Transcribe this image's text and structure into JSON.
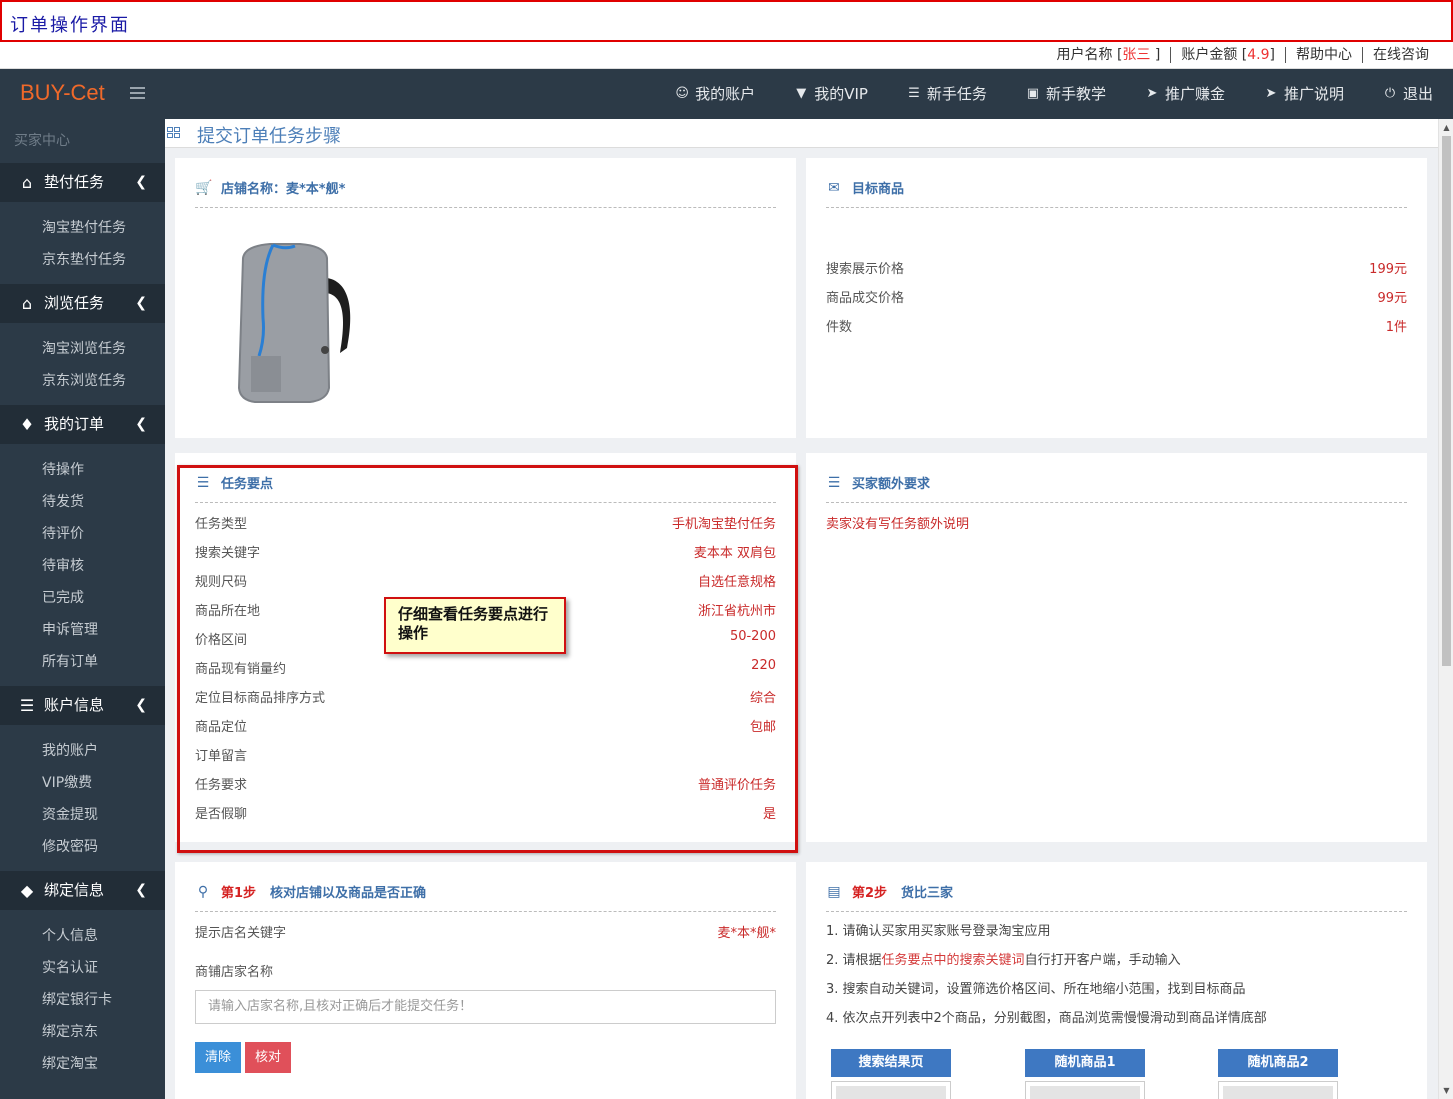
{
  "window_title": "订单操作界面",
  "topinfo": {
    "username_label": "用户名称 [",
    "username": "张三",
    "username_end": "]",
    "balance_label": "账户金额 [",
    "balance": "4.9",
    "balance_end": "]",
    "help": "帮助中心",
    "consult": "在线咨询"
  },
  "navbar": {
    "logo": "BUY-Cet",
    "links": [
      {
        "label": "我的账户",
        "icon": "user-icon"
      },
      {
        "label": "我的VIP",
        "icon": "vip-icon"
      },
      {
        "label": "新手任务",
        "icon": "task-icon"
      },
      {
        "label": "新手教学",
        "icon": "film-icon"
      },
      {
        "label": "推广赚金",
        "icon": "send-icon"
      },
      {
        "label": "推广说明",
        "icon": "send-icon"
      },
      {
        "label": "退出",
        "icon": "power-icon"
      }
    ]
  },
  "sidebar": {
    "header": "买家中心",
    "groups": [
      {
        "label": "垫付任务",
        "icon": "home-icon",
        "items": [
          "淘宝垫付任务",
          "京东垫付任务"
        ]
      },
      {
        "label": "浏览任务",
        "icon": "home-icon",
        "items": [
          "淘宝浏览任务",
          "京东浏览任务"
        ]
      },
      {
        "label": "我的订单",
        "icon": "tag-icon",
        "items": [
          "待操作",
          "待发货",
          "待评价",
          "待审核",
          "已完成",
          "申诉管理",
          "所有订单"
        ]
      },
      {
        "label": "账户信息",
        "icon": "layers-icon",
        "items": [
          "我的账户",
          "VIP缴费",
          "资金提现",
          "修改密码"
        ]
      },
      {
        "label": "绑定信息",
        "icon": "diamond-icon",
        "items": [
          "个人信息",
          "实名认证",
          "绑定银行卡",
          "绑定京东",
          "绑定淘宝"
        ]
      }
    ]
  },
  "page": {
    "title": "提交订单任务步骤"
  },
  "shop_card": {
    "title": "店铺名称：麦*本*舰*"
  },
  "target_card": {
    "title": "目标商品",
    "rows": [
      {
        "k": "搜索展示价格",
        "v": "199元"
      },
      {
        "k": "商品成交价格",
        "v": "99元"
      },
      {
        "k": "件数",
        "v": "1件"
      }
    ]
  },
  "task_card": {
    "title": "任务要点",
    "rows": [
      {
        "k": "任务类型",
        "v": "手机淘宝垫付任务"
      },
      {
        "k": "搜索关键字",
        "v": "麦本本 双肩包"
      },
      {
        "k": "规则尺码",
        "v": "自选任意规格"
      },
      {
        "k": "商品所在地",
        "v": "浙江省杭州市"
      },
      {
        "k": "价格区间",
        "v": "50-200"
      },
      {
        "k": "商品现有销量约",
        "v": "220"
      },
      {
        "k": "定位目标商品排序方式",
        "v": "综合"
      },
      {
        "k": "商品定位",
        "v": "包邮"
      },
      {
        "k": "订单留言",
        "v": ""
      },
      {
        "k": "任务要求",
        "v": "普通评价任务"
      },
      {
        "k": "是否假聊",
        "v": "是"
      }
    ]
  },
  "extra_card": {
    "title": "买家额外要求",
    "text": "卖家没有写任务额外说明"
  },
  "callout": {
    "text": "仔细查看任务要点进行操作"
  },
  "step1_card": {
    "step": "第1步",
    "title": "核对店铺以及商品是否正确",
    "hint_label": "提示店名关键字",
    "hint_value": "麦*本*舰*",
    "shop_label": "商铺店家名称",
    "input_placeholder": "请输入店家名称,且核对正确后才能提交任务！",
    "clear_label": "清除",
    "check_label": "核对",
    "clear_color": "#3b8fd8",
    "check_color": "#e0505a"
  },
  "step2_card": {
    "step": "第2步",
    "title": "货比三家",
    "line1": "1. 请确认买家用买家账号登录淘宝应用",
    "line2_pre": "2. 请根据",
    "line2_hl": "任务要点中的搜索关键词",
    "line2_post": "自行打开客户端，手动输入",
    "line3": "3. 搜索自动关键词，设置筛选价格区间、所在地缩小范围，找到目标商品",
    "line4": "4. 依次点开列表中2个商品，分别截图，商品浏览需慢慢滑动到商品详情底部",
    "buttons": [
      "搜索结果页",
      "随机商品1",
      "随机商品2"
    ]
  }
}
